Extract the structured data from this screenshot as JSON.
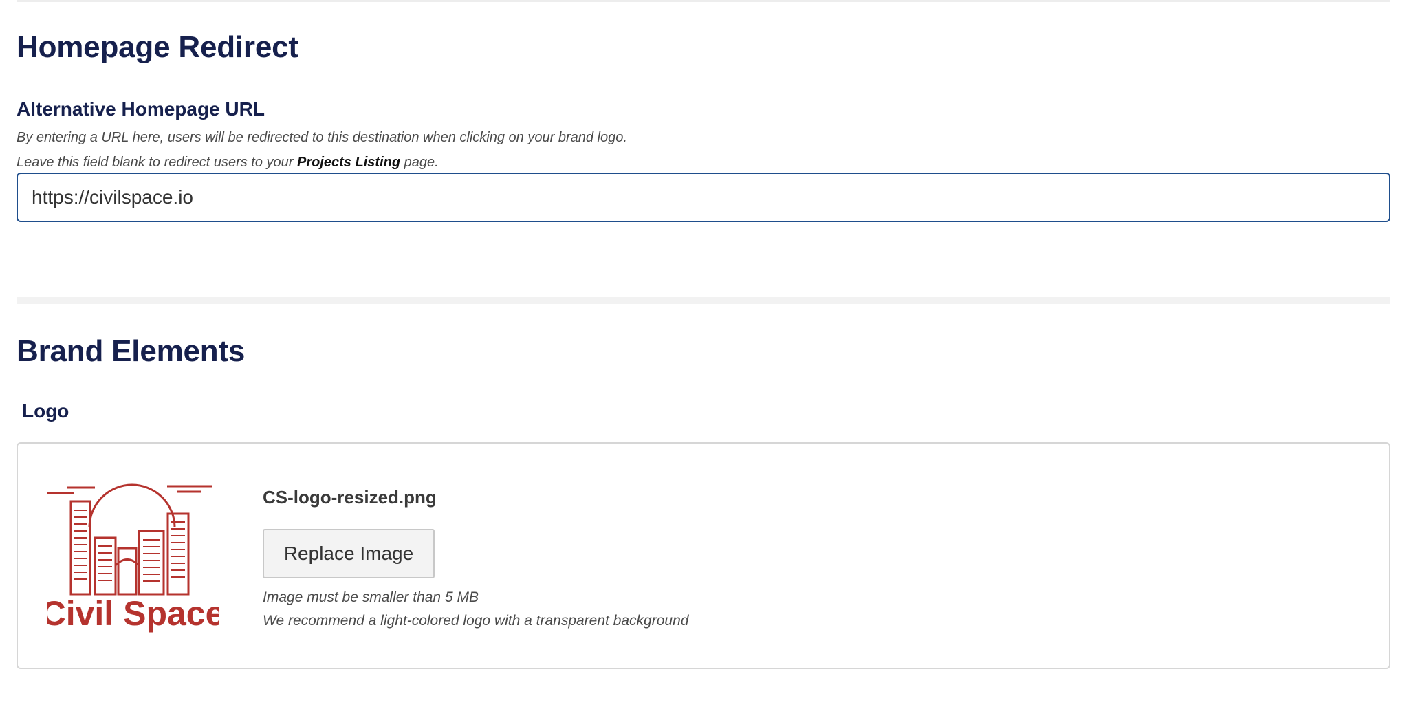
{
  "homepage_redirect": {
    "title": "Homepage Redirect",
    "field_label": "Alternative Homepage URL",
    "help_line_1": "By entering a URL here, users will be redirected to this destination when clicking on your brand logo.",
    "help_line_2_prefix": "Leave this field blank to redirect users to your ",
    "help_line_2_bold": "Projects Listing",
    "help_line_2_suffix": " page.",
    "url_value": "https://civilspace.io"
  },
  "brand_elements": {
    "title": "Brand Elements",
    "logo_label": "Logo",
    "logo": {
      "file_name": "CS-logo-resized.png",
      "replace_button_label": "Replace Image",
      "note_size": "Image must be smaller than 5 MB",
      "note_recommend": "We recommend a light-colored logo with a transparent background",
      "image_text": "Civil Space",
      "brand_color": "#b5332e"
    }
  },
  "colors": {
    "heading": "#16204d",
    "input_border": "#1f4e8c",
    "divider": "#f2f2f2"
  }
}
